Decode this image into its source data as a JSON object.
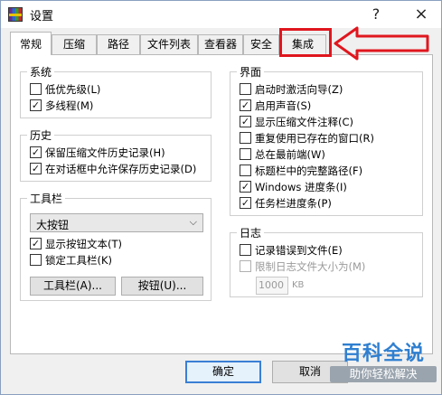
{
  "window": {
    "title": "设置",
    "help_label": "?",
    "close_label": "×"
  },
  "tabs": [
    {
      "label": "常规",
      "active": true
    },
    {
      "label": "压缩"
    },
    {
      "label": "路径"
    },
    {
      "label": "文件列表"
    },
    {
      "label": "查看器"
    },
    {
      "label": "安全"
    },
    {
      "label": "集成"
    }
  ],
  "groups": {
    "system": {
      "title": "系统",
      "items": [
        {
          "label": "低优先级(L)",
          "checked": false
        },
        {
          "label": "多线程(M)",
          "checked": true
        }
      ]
    },
    "history": {
      "title": "历史",
      "items": [
        {
          "label": "保留压缩文件历史记录(H)",
          "checked": true
        },
        {
          "label": "在对话框中允许保存历史记录(D)",
          "checked": true
        }
      ]
    },
    "toolbar": {
      "title": "工具栏",
      "select_value": "大按钮",
      "items": [
        {
          "label": "显示按钮文本(T)",
          "checked": true
        },
        {
          "label": "锁定工具栏(K)",
          "checked": false
        }
      ],
      "btn_toolbar": "工具栏(A)...",
      "btn_buttons": "按钮(U)..."
    },
    "interface": {
      "title": "界面",
      "items": [
        {
          "label": "启动时激活向导(Z)",
          "checked": false
        },
        {
          "label": "启用声音(S)",
          "checked": true
        },
        {
          "label": "显示压缩文件注释(C)",
          "checked": true
        },
        {
          "label": "重复使用已存在的窗口(R)",
          "checked": false
        },
        {
          "label": "总在最前端(W)",
          "checked": false
        },
        {
          "label": "标题栏中的完整路径(F)",
          "checked": false
        },
        {
          "label": "Windows 进度条(I)",
          "checked": true
        },
        {
          "label": "任务栏进度条(P)",
          "checked": true
        }
      ]
    },
    "log": {
      "title": "日志",
      "items": [
        {
          "label": "记录错误到文件(E)",
          "checked": false
        },
        {
          "label": "限制日志文件大小为(M)",
          "checked": false,
          "disabled": true
        }
      ],
      "size_value": "1000",
      "size_unit": "KB"
    }
  },
  "footer": {
    "ok_label": "确定",
    "cancel_label": "取消"
  },
  "watermark": {
    "main": "百科全说",
    "sub": "助你轻松解决"
  },
  "colors": {
    "annotation": "#e0161e",
    "accent": "#3a7fd5",
    "watermark_blue": "#2f7fd0"
  }
}
